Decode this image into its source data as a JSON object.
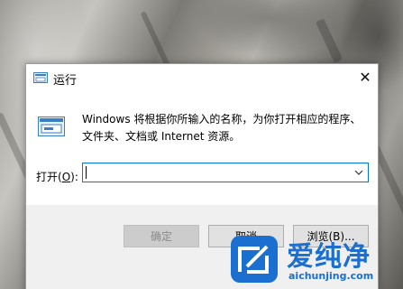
{
  "dialog": {
    "title": "运行",
    "close_label": "✕",
    "description": "Windows 将根据你所输入的名称，为你打开相应的程序、文件夹、文档或 Internet 资源。",
    "open_label": "打开(",
    "open_accel": "O",
    "open_label_end": "):",
    "open_value": "",
    "buttons": {
      "ok": "确定",
      "cancel": "取消",
      "browse": "浏览(B)..."
    }
  },
  "watermark": {
    "title": "爱纯净",
    "url": "aichunjing.com"
  },
  "colors": {
    "accent": "#0078d7",
    "brand": "#1b6fd1",
    "footer_bg": "#f0f0f0"
  }
}
